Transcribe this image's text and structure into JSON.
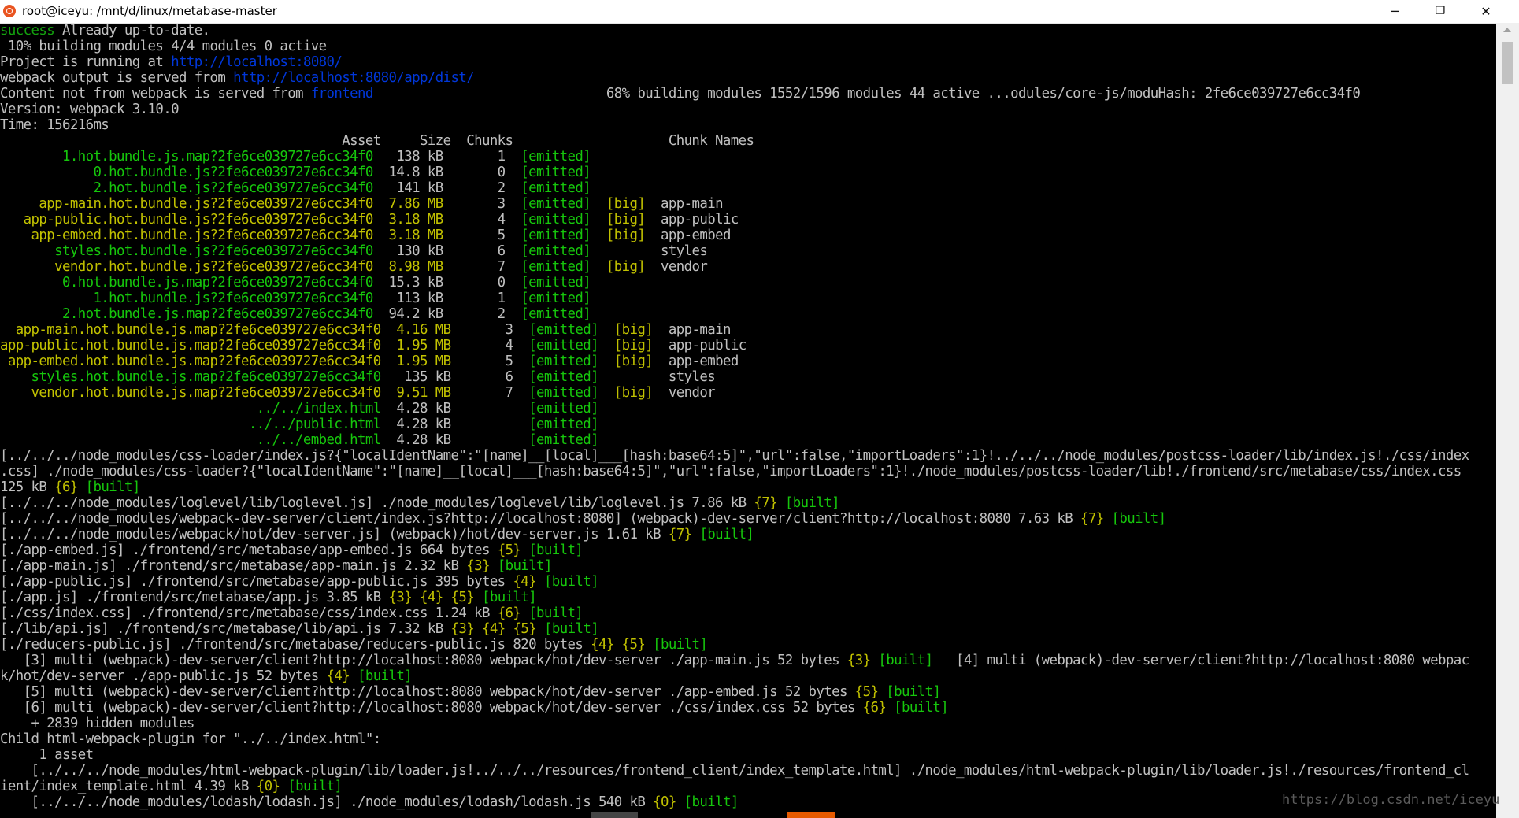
{
  "window": {
    "title": "root@iceyu: /mnt/d/linux/metabase-master",
    "minimize": "─",
    "maximize": "❐",
    "close": "✕"
  },
  "colors": {
    "green": "#13a10e",
    "bright_green": "#16c60c",
    "yellow": "#c1c100",
    "blue": "#0037da",
    "default": "#c0c0c0",
    "background": "#000000"
  },
  "terminal": {
    "lines": [
      [
        [
          "success",
          "green"
        ],
        [
          " Already up-to-date.",
          ""
        ]
      ],
      [
        [
          " 10% building modules 4/4 modules 0 active",
          ""
        ]
      ],
      [
        [
          "Project is running at ",
          ""
        ],
        [
          "http://localhost:8080/",
          "blue"
        ]
      ],
      [
        [
          "webpack output is served from ",
          ""
        ],
        [
          "http://localhost:8080/app/dist/",
          "blue"
        ]
      ],
      [
        [
          "Content not from webpack is served from ",
          ""
        ],
        [
          "frontend",
          "blue"
        ],
        [
          "                              68% building modules 1552/1596 modules 44 active ...odules/core-js/moduHash: 2fe6ce039727e6cc34f0",
          ""
        ]
      ],
      [
        [
          "Version: webpack 3.10.0",
          ""
        ]
      ],
      [
        [
          "Time: 156216ms",
          ""
        ]
      ],
      [
        [
          "                                            Asset     Size  Chunks                    Chunk Names",
          ""
        ]
      ],
      [
        [
          "        1.hot.bundle.js.map?2fe6ce039727e6cc34f0",
          "lgreen"
        ],
        [
          "   138 kB       1  ",
          ""
        ],
        [
          "[emitted]",
          "lgreen"
        ]
      ],
      [
        [
          "            0.hot.bundle.js?2fe6ce039727e6cc34f0",
          "lgreen"
        ],
        [
          "  14.8 kB       0  ",
          ""
        ],
        [
          "[emitted]",
          "lgreen"
        ]
      ],
      [
        [
          "            2.hot.bundle.js?2fe6ce039727e6cc34f0",
          "lgreen"
        ],
        [
          "   141 kB       2  ",
          ""
        ],
        [
          "[emitted]",
          "lgreen"
        ]
      ],
      [
        [
          "     app-main.hot.bundle.js?2fe6ce039727e6cc34f0  7.86 MB",
          "yellow"
        ],
        [
          "       3  ",
          ""
        ],
        [
          "[emitted]",
          "lgreen"
        ],
        [
          "  ",
          ""
        ],
        [
          "[big]",
          "yellow"
        ],
        [
          "  app-main",
          ""
        ]
      ],
      [
        [
          "   app-public.hot.bundle.js?2fe6ce039727e6cc34f0  3.18 MB",
          "yellow"
        ],
        [
          "       4  ",
          ""
        ],
        [
          "[emitted]",
          "lgreen"
        ],
        [
          "  ",
          ""
        ],
        [
          "[big]",
          "yellow"
        ],
        [
          "  app-public",
          ""
        ]
      ],
      [
        [
          "    app-embed.hot.bundle.js?2fe6ce039727e6cc34f0  3.18 MB",
          "yellow"
        ],
        [
          "       5  ",
          ""
        ],
        [
          "[emitted]",
          "lgreen"
        ],
        [
          "  ",
          ""
        ],
        [
          "[big]",
          "yellow"
        ],
        [
          "  app-embed",
          ""
        ]
      ],
      [
        [
          "       styles.hot.bundle.js?2fe6ce039727e6cc34f0",
          "lgreen"
        ],
        [
          "   130 kB       6  ",
          ""
        ],
        [
          "[emitted]",
          "lgreen"
        ],
        [
          "         styles",
          ""
        ]
      ],
      [
        [
          "       vendor.hot.bundle.js?2fe6ce039727e6cc34f0  8.98 MB",
          "yellow"
        ],
        [
          "       7  ",
          ""
        ],
        [
          "[emitted]",
          "lgreen"
        ],
        [
          "  ",
          ""
        ],
        [
          "[big]",
          "yellow"
        ],
        [
          "  vendor",
          ""
        ]
      ],
      [
        [
          "        0.hot.bundle.js.map?2fe6ce039727e6cc34f0",
          "lgreen"
        ],
        [
          "  15.3 kB       0  ",
          ""
        ],
        [
          "[emitted]",
          "lgreen"
        ]
      ],
      [
        [
          "            1.hot.bundle.js?2fe6ce039727e6cc34f0",
          "lgreen"
        ],
        [
          "   113 kB       1  ",
          ""
        ],
        [
          "[emitted]",
          "lgreen"
        ]
      ],
      [
        [
          "        2.hot.bundle.js.map?2fe6ce039727e6cc34f0",
          "lgreen"
        ],
        [
          "  94.2 kB       2  ",
          ""
        ],
        [
          "[emitted]",
          "lgreen"
        ]
      ],
      [
        [
          "  app-main.hot.bundle.js.map?2fe6ce039727e6cc34f0  4.16 MB",
          "yellow"
        ],
        [
          "       3  ",
          ""
        ],
        [
          "[emitted]",
          "lgreen"
        ],
        [
          "  ",
          ""
        ],
        [
          "[big]",
          "yellow"
        ],
        [
          "  app-main",
          ""
        ]
      ],
      [
        [
          "app-public.hot.bundle.js.map?2fe6ce039727e6cc34f0  1.95 MB",
          "yellow"
        ],
        [
          "       4  ",
          ""
        ],
        [
          "[emitted]",
          "lgreen"
        ],
        [
          "  ",
          ""
        ],
        [
          "[big]",
          "yellow"
        ],
        [
          "  app-public",
          ""
        ]
      ],
      [
        [
          " app-embed.hot.bundle.js.map?2fe6ce039727e6cc34f0  1.95 MB",
          "yellow"
        ],
        [
          "       5  ",
          ""
        ],
        [
          "[emitted]",
          "lgreen"
        ],
        [
          "  ",
          ""
        ],
        [
          "[big]",
          "yellow"
        ],
        [
          "  app-embed",
          ""
        ]
      ],
      [
        [
          "    styles.hot.bundle.js.map?2fe6ce039727e6cc34f0",
          "lgreen"
        ],
        [
          "   135 kB       6  ",
          ""
        ],
        [
          "[emitted]",
          "lgreen"
        ],
        [
          "         styles",
          ""
        ]
      ],
      [
        [
          "    vendor.hot.bundle.js.map?2fe6ce039727e6cc34f0  9.51 MB",
          "yellow"
        ],
        [
          "       7  ",
          ""
        ],
        [
          "[emitted]",
          "lgreen"
        ],
        [
          "  ",
          ""
        ],
        [
          "[big]",
          "yellow"
        ],
        [
          "  vendor",
          ""
        ]
      ],
      [
        [
          "                                 ../../index.html",
          "lgreen"
        ],
        [
          "  4.28 kB          ",
          ""
        ],
        [
          "[emitted]",
          "lgreen"
        ]
      ],
      [
        [
          "                                ../../public.html",
          "lgreen"
        ],
        [
          "  4.28 kB          ",
          ""
        ],
        [
          "[emitted]",
          "lgreen"
        ]
      ],
      [
        [
          "                                 ../../embed.html",
          "lgreen"
        ],
        [
          "  4.28 kB          ",
          ""
        ],
        [
          "[emitted]",
          "lgreen"
        ]
      ],
      [
        [
          "[../../../node_modules/css-loader/index.js?{\"localIdentName\":\"[name]__[local]___[hash:base64:5]\",\"url\":false,\"importLoaders\":1}!../../../node_modules/postcss-loader/lib/index.js!./css/index",
          ""
        ]
      ],
      [
        [
          ".css] ./node_modules/css-loader?{\"localIdentName\":\"[name]__[local]___[hash:base64:5]\",\"url\":false,\"importLoaders\":1}!./node_modules/postcss-loader/lib!./frontend/src/metabase/css/index.css",
          ""
        ]
      ],
      [
        [
          "125 kB ",
          ""
        ],
        [
          "{6}",
          "yellow"
        ],
        [
          " ",
          ""
        ],
        [
          "[built]",
          "lgreen"
        ]
      ],
      [
        [
          "[../../../node_modules/loglevel/lib/loglevel.js] ./node_modules/loglevel/lib/loglevel.js 7.86 kB ",
          ""
        ],
        [
          "{7}",
          "yellow"
        ],
        [
          " ",
          ""
        ],
        [
          "[built]",
          "lgreen"
        ]
      ],
      [
        [
          "[../../../node_modules/webpack-dev-server/client/index.js?http://localhost:8080] (webpack)-dev-server/client?http://localhost:8080 7.63 kB ",
          ""
        ],
        [
          "{7}",
          "yellow"
        ],
        [
          " ",
          ""
        ],
        [
          "[built]",
          "lgreen"
        ]
      ],
      [
        [
          "[../../../node_modules/webpack/hot/dev-server.js] (webpack)/hot/dev-server.js 1.61 kB ",
          ""
        ],
        [
          "{7}",
          "yellow"
        ],
        [
          " ",
          ""
        ],
        [
          "[built]",
          "lgreen"
        ]
      ],
      [
        [
          "[./app-embed.js] ./frontend/src/metabase/app-embed.js 664 bytes ",
          ""
        ],
        [
          "{5}",
          "yellow"
        ],
        [
          " ",
          ""
        ],
        [
          "[built]",
          "lgreen"
        ]
      ],
      [
        [
          "[./app-main.js] ./frontend/src/metabase/app-main.js 2.32 kB ",
          ""
        ],
        [
          "{3}",
          "yellow"
        ],
        [
          " ",
          ""
        ],
        [
          "[built]",
          "lgreen"
        ]
      ],
      [
        [
          "[./app-public.js] ./frontend/src/metabase/app-public.js 395 bytes ",
          ""
        ],
        [
          "{4}",
          "yellow"
        ],
        [
          " ",
          ""
        ],
        [
          "[built]",
          "lgreen"
        ]
      ],
      [
        [
          "[./app.js] ./frontend/src/metabase/app.js 3.85 kB ",
          ""
        ],
        [
          "{3}",
          "yellow"
        ],
        [
          " ",
          ""
        ],
        [
          "{4}",
          "yellow"
        ],
        [
          " ",
          ""
        ],
        [
          "{5}",
          "yellow"
        ],
        [
          " ",
          ""
        ],
        [
          "[built]",
          "lgreen"
        ]
      ],
      [
        [
          "[./css/index.css] ./frontend/src/metabase/css/index.css 1.24 kB ",
          ""
        ],
        [
          "{6}",
          "yellow"
        ],
        [
          " ",
          ""
        ],
        [
          "[built]",
          "lgreen"
        ]
      ],
      [
        [
          "[./lib/api.js] ./frontend/src/metabase/lib/api.js 7.32 kB ",
          ""
        ],
        [
          "{3}",
          "yellow"
        ],
        [
          " ",
          ""
        ],
        [
          "{4}",
          "yellow"
        ],
        [
          " ",
          ""
        ],
        [
          "{5}",
          "yellow"
        ],
        [
          " ",
          ""
        ],
        [
          "[built]",
          "lgreen"
        ]
      ],
      [
        [
          "[./reducers-public.js] ./frontend/src/metabase/reducers-public.js 820 bytes ",
          ""
        ],
        [
          "{4}",
          "yellow"
        ],
        [
          " ",
          ""
        ],
        [
          "{5}",
          "yellow"
        ],
        [
          " ",
          ""
        ],
        [
          "[built]",
          "lgreen"
        ]
      ],
      [
        [
          "   [3] multi (webpack)-dev-server/client?http://localhost:8080 webpack/hot/dev-server ./app-main.js 52 bytes ",
          ""
        ],
        [
          "{3}",
          "yellow"
        ],
        [
          " ",
          ""
        ],
        [
          "[built]",
          "lgreen"
        ],
        [
          "   [4] multi (webpack)-dev-server/client?http://localhost:8080 webpac",
          ""
        ]
      ],
      [
        [
          "k/hot/dev-server ./app-public.js 52 bytes ",
          ""
        ],
        [
          "{4}",
          "yellow"
        ],
        [
          " ",
          ""
        ],
        [
          "[built]",
          "lgreen"
        ]
      ],
      [
        [
          "   [5] multi (webpack)-dev-server/client?http://localhost:8080 webpack/hot/dev-server ./app-embed.js 52 bytes ",
          ""
        ],
        [
          "{5}",
          "yellow"
        ],
        [
          " ",
          ""
        ],
        [
          "[built]",
          "lgreen"
        ]
      ],
      [
        [
          "   [6] multi (webpack)-dev-server/client?http://localhost:8080 webpack/hot/dev-server ./css/index.css 52 bytes ",
          ""
        ],
        [
          "{6}",
          "yellow"
        ],
        [
          " ",
          ""
        ],
        [
          "[built]",
          "lgreen"
        ]
      ],
      [
        [
          "    + 2839 hidden modules",
          ""
        ]
      ],
      [
        [
          "Child html-webpack-plugin for \"../../index.html\":",
          ""
        ]
      ],
      [
        [
          "     1 asset",
          ""
        ]
      ],
      [
        [
          "    [../../../node_modules/html-webpack-plugin/lib/loader.js!../../../resources/frontend_client/index_template.html] ./node_modules/html-webpack-plugin/lib/loader.js!./resources/frontend_cl",
          ""
        ]
      ],
      [
        [
          "ient/index_template.html 4.39 kB ",
          ""
        ],
        [
          "{0}",
          "yellow"
        ],
        [
          " ",
          ""
        ],
        [
          "[built]",
          "lgreen"
        ]
      ],
      [
        [
          "    [../../../node_modules/lodash/lodash.js] ./node_modules/lodash/lodash.js 540 kB ",
          ""
        ],
        [
          "{0}",
          "yellow"
        ],
        [
          " ",
          ""
        ],
        [
          "[built]",
          "lgreen"
        ]
      ]
    ]
  },
  "watermark": "https://blog.csdn.net/iceyu"
}
